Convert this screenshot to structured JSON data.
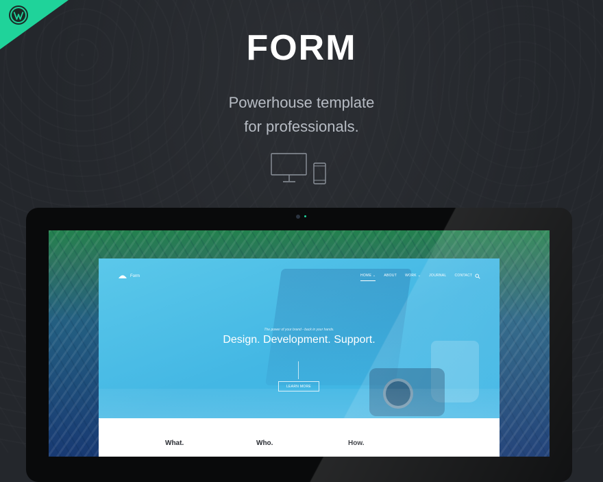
{
  "header": {
    "title": "FORM",
    "subtitle_line1": "Powerhouse template",
    "subtitle_line2": "for professionals."
  },
  "colors": {
    "background": "#24272c",
    "accent": "#1fd39a",
    "hero": "#43b7e4"
  },
  "icons": [
    "wordpress-icon",
    "desktop-icon",
    "mobile-icon",
    "umbrella-logo-icon",
    "search-icon"
  ],
  "site": {
    "logo_text": "Form",
    "nav": [
      {
        "label": "HOME",
        "has_dropdown": true,
        "active": true
      },
      {
        "label": "ABOUT",
        "has_dropdown": false,
        "active": false
      },
      {
        "label": "WORK",
        "has_dropdown": true,
        "active": false
      },
      {
        "label": "JOURNAL",
        "has_dropdown": false,
        "active": false
      },
      {
        "label": "CONTACT",
        "has_dropdown": false,
        "active": false
      }
    ],
    "hero_tagline": "The power of your brand - back in your hands.",
    "hero_title": "Design. Development. Support.",
    "hero_button": "LEARN MORE",
    "features": [
      "What.",
      "Who.",
      "How."
    ]
  }
}
